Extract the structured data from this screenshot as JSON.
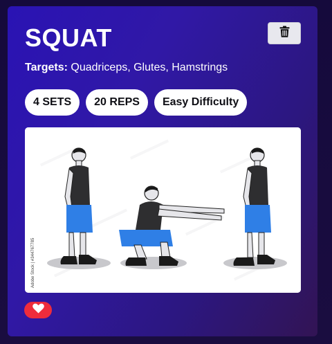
{
  "exercise": {
    "name": "SQUAT",
    "targets_label": "Targets:",
    "targets_value": "Quadriceps, Glutes, Hamstrings",
    "sets": "4 SETS",
    "reps": "20 REPS",
    "difficulty": "Easy Difficulty"
  },
  "image": {
    "alt": "Squat exercise illustration",
    "watermark": "Adobe Stock | #344767785"
  },
  "icons": {
    "delete": "trash-icon",
    "favorite": "heart-icon"
  },
  "colors": {
    "card_start": "#2a13b4",
    "card_end": "#321454",
    "favorite": "#ee2c3c",
    "delete_bg": "#e8e8ee"
  }
}
